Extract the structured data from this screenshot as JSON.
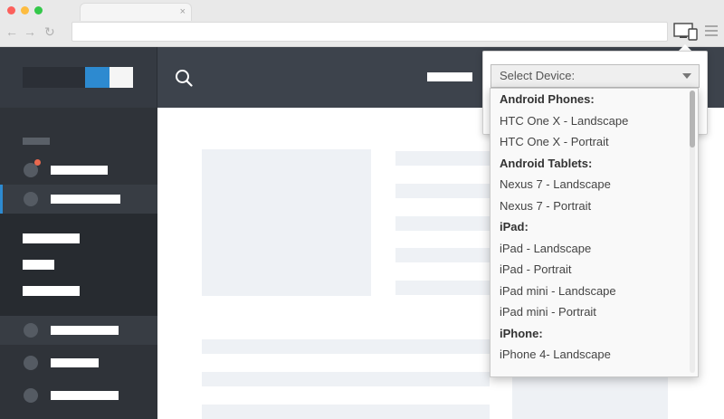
{
  "browser": {
    "tab_close": "×",
    "nav_back": "←",
    "nav_forward": "→",
    "nav_reload": "↻"
  },
  "device_select": {
    "placeholder": "Select Device:",
    "options": [
      {
        "label": "Android Phones:",
        "group": true
      },
      {
        "label": "HTC One X - Landscape",
        "group": false
      },
      {
        "label": "HTC One X - Portrait",
        "group": false
      },
      {
        "label": "Android Tablets:",
        "group": true
      },
      {
        "label": "Nexus 7 - Landscape",
        "group": false
      },
      {
        "label": "Nexus 7 - Portrait",
        "group": false
      },
      {
        "label": "iPad:",
        "group": true
      },
      {
        "label": "iPad - Landscape",
        "group": false
      },
      {
        "label": "iPad - Portrait",
        "group": false
      },
      {
        "label": "iPad mini - Landscape",
        "group": false
      },
      {
        "label": "iPad mini - Portrait",
        "group": false
      },
      {
        "label": "iPhone:",
        "group": true
      },
      {
        "label": "iPhone 4- Landscape",
        "group": false
      }
    ]
  },
  "colors": {
    "accent": "#2d8ad0",
    "header_bg": "#3d434c",
    "sidebar_bg": "#2f3339",
    "notification": "#e9694f"
  }
}
